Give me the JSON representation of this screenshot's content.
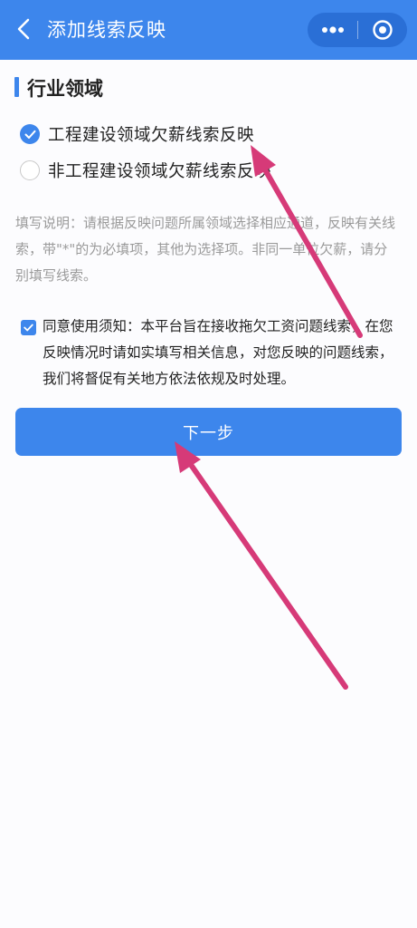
{
  "header": {
    "title": "添加线索反映",
    "back_icon": "chevron-left-icon",
    "more_icon": "more-dots-icon",
    "close_icon": "target-circle-icon"
  },
  "section": {
    "title": "行业领域"
  },
  "options": [
    {
      "label": "工程建设领域欠薪线索反映",
      "selected": true
    },
    {
      "label": "非工程建设领域欠薪线索反映",
      "selected": false
    }
  ],
  "instruction": "填写说明：请根据反映问题所属领域选择相应通道，反映有关线索，带\"*\"的为必填项，其他为选择项。非同一单位欠薪，请分别填写线索。",
  "agreement": {
    "checked": true,
    "text": "同意使用须知：本平台旨在接收拖欠工资问题线索，在您反映情况时请如实填写相关信息，对您反映的问题线索，我们将督促有关地方依法依规及时处理。"
  },
  "next_button": {
    "label": "下一步"
  },
  "colors": {
    "primary": "#3d86ec",
    "annotation_arrow": "#d63a78"
  }
}
